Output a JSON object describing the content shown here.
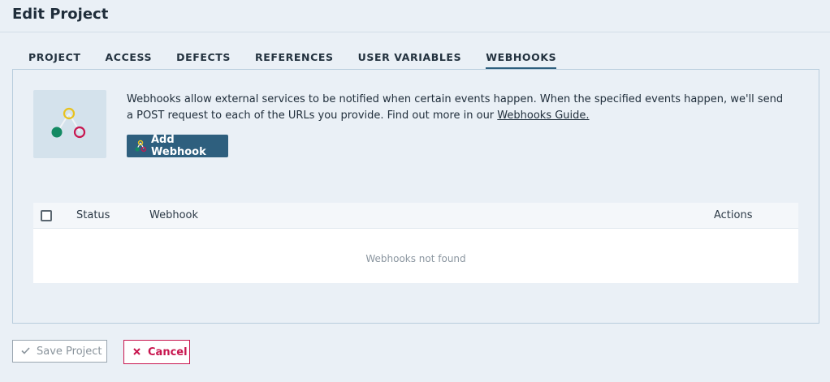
{
  "header": {
    "title": "Edit Project"
  },
  "tabs": [
    {
      "label": "PROJECT"
    },
    {
      "label": "ACCESS"
    },
    {
      "label": "DEFECTS"
    },
    {
      "label": "REFERENCES"
    },
    {
      "label": "USER VARIABLES"
    },
    {
      "label": "WEBHOOKS",
      "active": true
    }
  ],
  "webhooks": {
    "intro_text": "Webhooks allow external services to be notified when certain events happen. When the specified events happen, we'll send a POST request to each of the URLs you provide. Find out more in our ",
    "guide_link": "Webhooks Guide.",
    "add_button": "Add Webhook",
    "icon": "webhook-icon"
  },
  "table": {
    "columns": [
      "Status",
      "Webhook",
      "Actions"
    ],
    "empty_message": "Webhooks not found"
  },
  "footer": {
    "save_label": "Save Project",
    "cancel_label": "Cancel"
  },
  "colors": {
    "accent": "#2e5f7e",
    "danger": "#c8164f",
    "webhook_yellow": "#e8c21e",
    "webhook_green": "#138a63",
    "webhook_red": "#c8164f"
  }
}
